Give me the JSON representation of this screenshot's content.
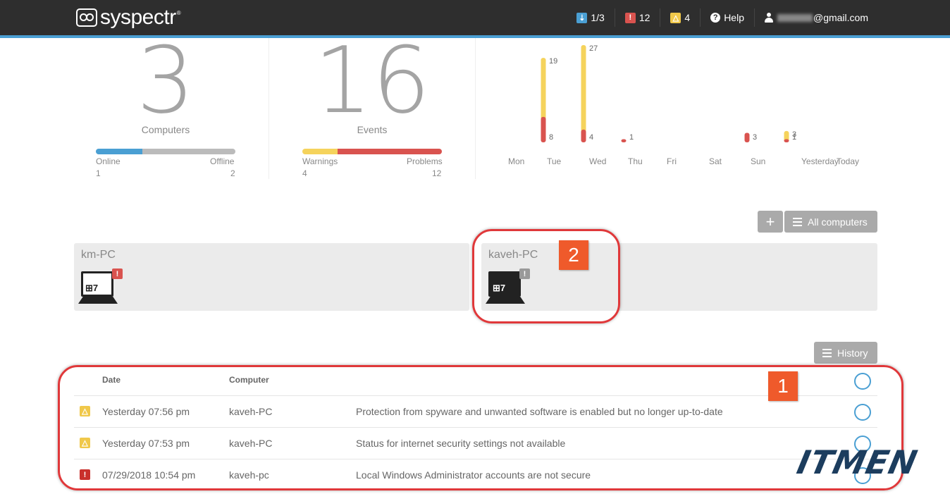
{
  "brand": {
    "name": "syspectr",
    "reg": "®"
  },
  "nav": {
    "computers_badge": "1/3",
    "problems_count": "12",
    "warnings_count": "4",
    "help_label": "Help",
    "user_email": "@gmail.com"
  },
  "computers": {
    "count": "3",
    "label": "Computers",
    "online_label": "Online",
    "offline_label": "Offline",
    "online": "1",
    "offline": "2",
    "online_fraction": 0.333
  },
  "events": {
    "count": "16",
    "label": "Events",
    "warnings_label": "Warnings",
    "problems_label": "Problems",
    "warnings": "4",
    "problems": "12",
    "warnings_fraction": 0.25
  },
  "colors": {
    "blue": "#4a9fd3",
    "gray": "#bbbbbb",
    "yellow": "#f5d35c",
    "red": "#d9534f"
  },
  "chart_data": {
    "type": "bar",
    "stacked": true,
    "categories": [
      "Mon",
      "Tue",
      "Wed",
      "Thu",
      "Fri",
      "Sat",
      "Sun",
      "Yesterday",
      "Today"
    ],
    "series": [
      {
        "values": [
          0,
          8,
          4,
          1,
          0,
          0,
          3,
          1,
          0
        ],
        "color": "#d9534f"
      },
      {
        "values": [
          0,
          19,
          27,
          0,
          0,
          0,
          0,
          3,
          0
        ],
        "color": "#f5d35c"
      }
    ],
    "labels_top": [
      "",
      "19",
      "27",
      "",
      "",
      "",
      "",
      "3",
      ""
    ],
    "labels_bottom": [
      "",
      "8",
      "4",
      "1",
      "",
      "",
      "3",
      "1",
      ""
    ]
  },
  "toolbar": {
    "add_label": "+",
    "all_computers_label": "All computers",
    "history_label": "History"
  },
  "cards": [
    {
      "name": "km-PC",
      "os": "⊞7",
      "alert": "!"
    },
    {
      "name": "kaveh-PC",
      "os": "⊞7",
      "alert": "!"
    }
  ],
  "table": {
    "headers": {
      "date": "Date",
      "computer": "Computer"
    },
    "rows": [
      {
        "type": "warning",
        "icon": "△",
        "date": "Yesterday 07:56 pm",
        "computer": "kaveh-PC",
        "message": "Protection from spyware and unwanted software is enabled but no longer up-to-date"
      },
      {
        "type": "warning",
        "icon": "△",
        "date": "Yesterday 07:53 pm",
        "computer": "kaveh-PC",
        "message": "Status for internet security settings not available"
      },
      {
        "type": "problem",
        "icon": "!",
        "date": "07/29/2018 10:54 pm",
        "computer": "kaveh-pc",
        "message": "Local Windows Administrator accounts are not secure"
      }
    ]
  },
  "annotations": {
    "callout_1": "1",
    "callout_2": "2"
  },
  "watermark": "ITMEN"
}
